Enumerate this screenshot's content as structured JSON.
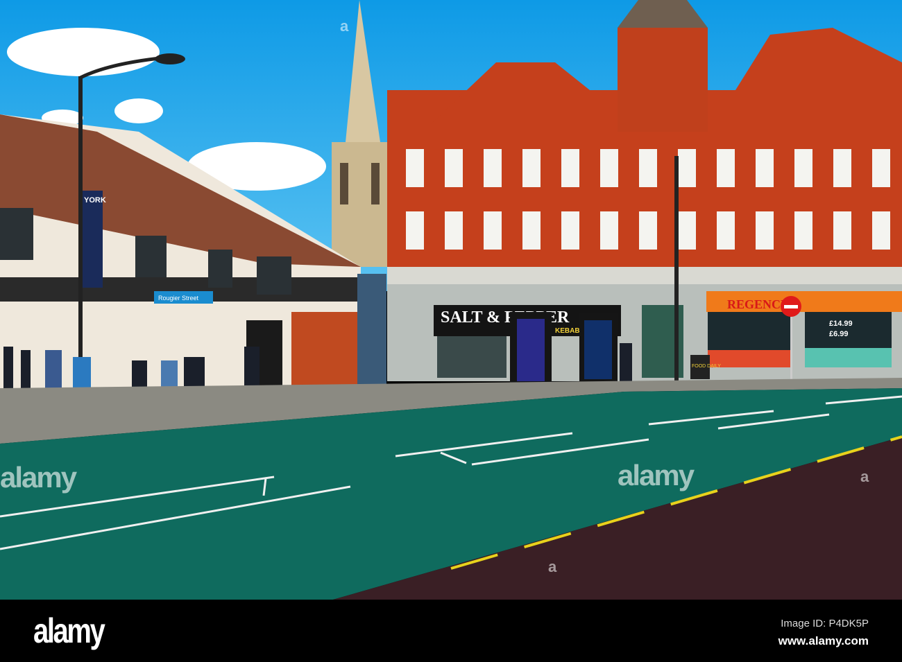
{
  "photo": {
    "signs": {
      "york_banner": "YORK",
      "bus_stop_street": "Rougier Street",
      "shop1": "SALT & PEPPER",
      "shop1_menu": "KEBABS",
      "shop2": "REGENCY",
      "shop2_price1": "£14.99",
      "shop2_price2": "£6.99",
      "sandwich_board": "FOOD DAILY"
    },
    "colors": {
      "sky": "#1fa6e8",
      "brick": "#c5401c",
      "road": "#0f6b5e",
      "pavement": "#2a2a2a",
      "footer": "#000000"
    }
  },
  "watermark": {
    "text": "alamy",
    "mark": "a"
  },
  "footer": {
    "logo": "alamy",
    "image_id": "Image ID: P4DK5P",
    "website": "www.alamy.com"
  }
}
